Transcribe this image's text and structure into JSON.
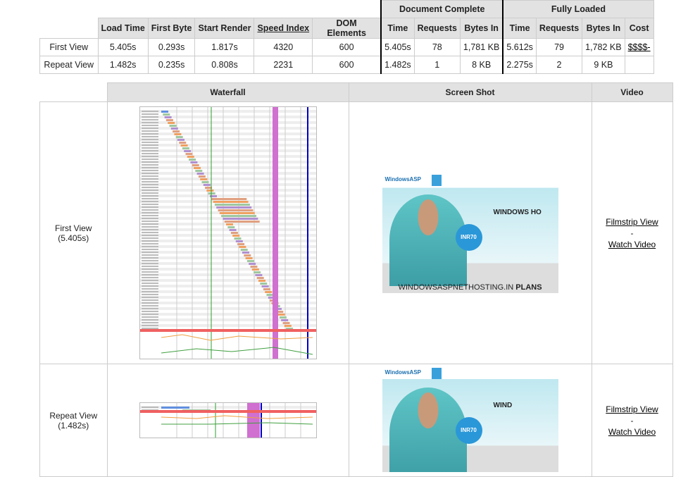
{
  "summary": {
    "groups": {
      "doc": "Document Complete",
      "full": "Fully Loaded"
    },
    "headers": [
      "Load Time",
      "First Byte",
      "Start Render",
      "Speed Index",
      "DOM Elements",
      "Time",
      "Requests",
      "Bytes In",
      "Time",
      "Requests",
      "Bytes In",
      "Cost"
    ],
    "rows": [
      {
        "label": "First View",
        "cells": [
          "5.405s",
          "0.293s",
          "1.817s",
          "4320",
          "600",
          "5.405s",
          "78",
          "1,781 KB",
          "5.612s",
          "79",
          "1,782 KB",
          "$$$$-"
        ]
      },
      {
        "label": "Repeat View",
        "cells": [
          "1.482s",
          "0.235s",
          "0.808s",
          "2231",
          "600",
          "1.482s",
          "1",
          "8 KB",
          "2.275s",
          "2",
          "9 KB",
          ""
        ]
      }
    ]
  },
  "details": {
    "headers": {
      "waterfall": "Waterfall",
      "screenshot": "Screen Shot",
      "video": "Video"
    },
    "rows": [
      {
        "label": "First View",
        "time": "(5.405s)",
        "filmstrip": "Filmstrip View",
        "dash": "-",
        "video": "Watch Video",
        "shot_heading": "WINDOWS HO",
        "shot_plans_a": "WINDOWSASPNETHOSTING.IN ",
        "shot_plans_b": "PLANS",
        "badge": "INR70",
        "logo": "WindowsASP"
      },
      {
        "label": "Repeat View",
        "time": "(1.482s)",
        "filmstrip": "Filmstrip View",
        "dash": "-",
        "video": "Watch Video",
        "shot_heading": "WIND",
        "badge": "INR70",
        "logo": "WindowsASP"
      }
    ]
  },
  "colors": {
    "start_render": "#28a028",
    "doc_complete": "#0000cc",
    "dom_load": "#d070d0",
    "error_row": "#f06060"
  }
}
